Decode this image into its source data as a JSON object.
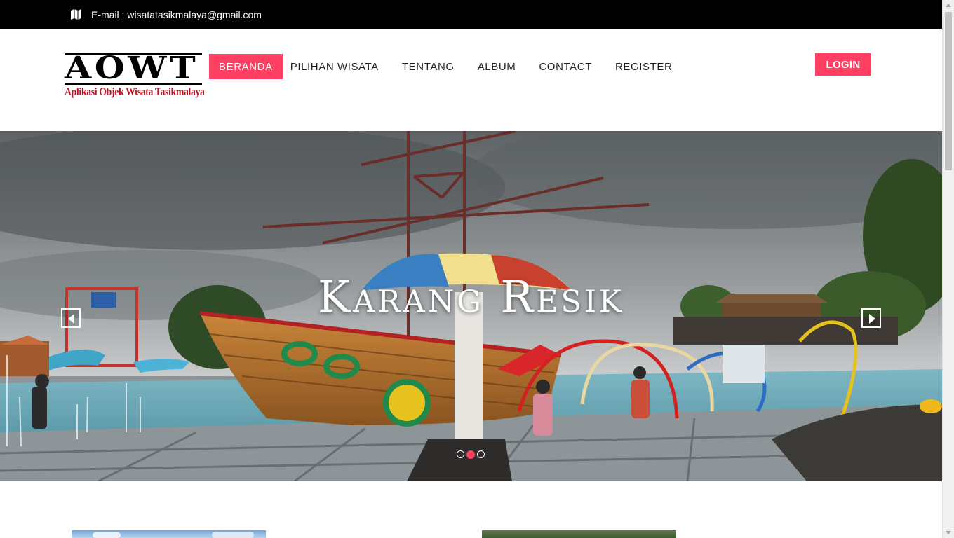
{
  "topbar": {
    "email_text": "E-mail : wisatatasikmalaya@gmail.com",
    "icon": "map-icon"
  },
  "logo": {
    "title": "AOWT",
    "subtitle": "Aplikasi Objek Wisata Tasikmalaya",
    "subtitle_color": "#c1121f"
  },
  "nav": {
    "items": [
      {
        "label": "BERANDA",
        "active": true
      },
      {
        "label": "PILIHAN WISATA",
        "active": false
      },
      {
        "label": "TENTANG",
        "active": false
      },
      {
        "label": "ALBUM",
        "active": false
      },
      {
        "label": "CONTACT",
        "active": false
      },
      {
        "label": "REGISTER",
        "active": false
      }
    ],
    "accent_color": "#ff4062"
  },
  "login": {
    "label": "LOGIN"
  },
  "hero": {
    "caption": "Karang Resik",
    "slide_count": 3,
    "active_slide": 2,
    "prev_icon": "chevron-left-icon",
    "next_icon": "chevron-right-icon"
  }
}
